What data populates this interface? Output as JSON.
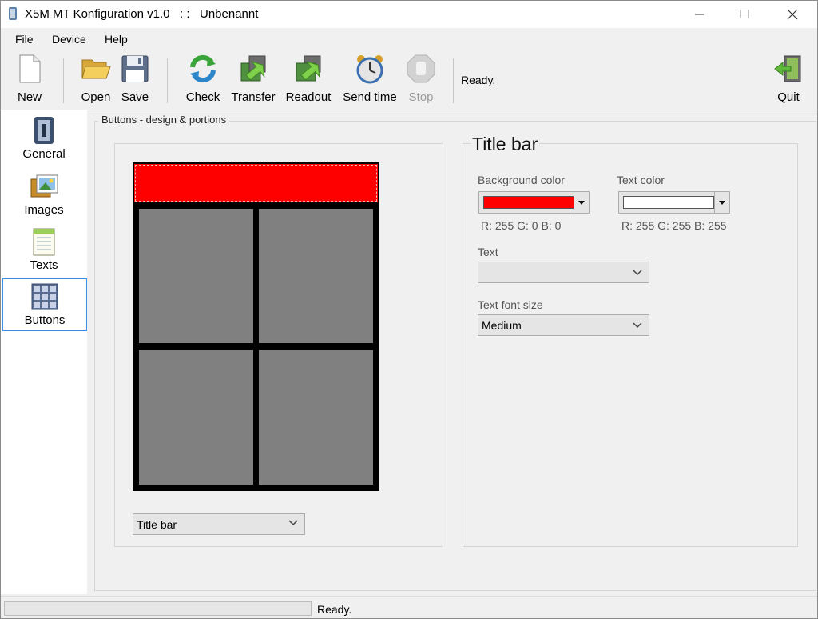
{
  "window": {
    "title": "X5M MT Konfiguration v1.0   : :   Unbenannt"
  },
  "menu": [
    "File",
    "Device",
    "Help"
  ],
  "toolbar": {
    "new": "New",
    "open": "Open",
    "save": "Save",
    "check": "Check",
    "transfer": "Transfer",
    "readout": "Readout",
    "send_time": "Send time",
    "stop": "Stop",
    "quit": "Quit",
    "status": "Ready."
  },
  "nav": {
    "items": [
      {
        "label": "General",
        "icon": "switch-icon"
      },
      {
        "label": "Images",
        "icon": "images-icon"
      },
      {
        "label": "Texts",
        "icon": "notepad-icon"
      },
      {
        "label": "Buttons",
        "icon": "grid-icon",
        "selected": true
      }
    ]
  },
  "group": {
    "label": "Buttons - design & portions"
  },
  "preview": {
    "title_bar_color": "#ff0000",
    "button_color": "#808080",
    "frame_color": "#000000",
    "selector_value": "Title bar"
  },
  "properties": {
    "heading": "Title bar",
    "background_color_label": "Background color",
    "background_color": "#ff0000",
    "background_rgb": "R: 255 G: 0 B: 0",
    "text_color_label": "Text color",
    "text_color": "#ffffff",
    "text_rgb": "R: 255 G: 255 B: 255",
    "text_label": "Text",
    "text_value": "",
    "font_size_label": "Text font size",
    "font_size_value": "Medium"
  },
  "statusbar": {
    "text": "Ready.",
    "progress": 0
  }
}
